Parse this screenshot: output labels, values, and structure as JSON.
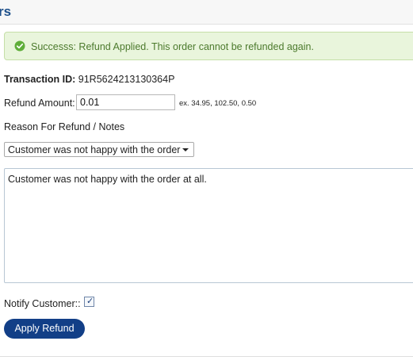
{
  "header": {
    "title": "rs"
  },
  "alert": {
    "message": "Successs: Refund Applied. This order cannot be refunded again."
  },
  "transaction": {
    "label": "Transaction ID:",
    "value": "91R5624213130364P"
  },
  "refund_amount": {
    "label": "Refund Amount:",
    "value": "0.01",
    "hint": "ex. 34.95, 102.50, 0.50"
  },
  "reason": {
    "label": "Reason For Refund / Notes",
    "selected": "Customer was not happy with the order",
    "notes": "Customer was not happy with the order at all."
  },
  "notify": {
    "label": "Notify Customer::",
    "checked": true
  },
  "submit": {
    "label": "Apply Refund"
  },
  "colors": {
    "accent": "#123f87",
    "success_bg": "#e9f5dc",
    "success_text": "#4c7a2d",
    "title": "#1d4f8a"
  }
}
